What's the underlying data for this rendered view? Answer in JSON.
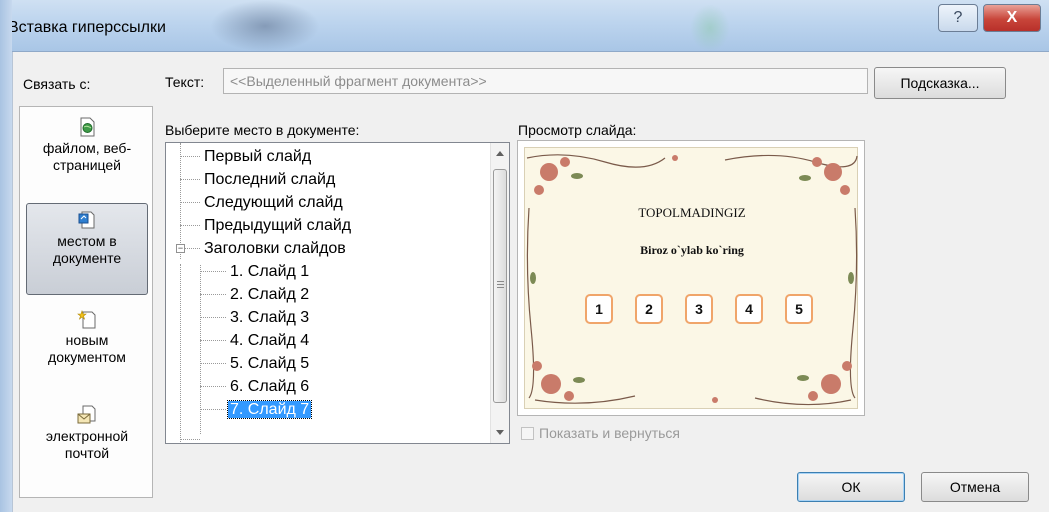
{
  "window": {
    "title": "Вставка гиперссылки",
    "help_glyph": "?",
    "close_glyph": "X"
  },
  "link_to": {
    "label": "Связать с:",
    "options": [
      {
        "icon": "web-page-file-icon",
        "label_lines": [
          "файлом, веб-",
          "страницей"
        ],
        "selected": false
      },
      {
        "icon": "document-place-icon",
        "label_lines": [
          "местом в",
          "документе"
        ],
        "selected": true
      },
      {
        "icon": "new-document-icon",
        "label_lines": [
          "новым",
          "документом"
        ],
        "selected": false
      },
      {
        "icon": "email-icon",
        "label_lines": [
          "электронной",
          "почтой"
        ],
        "selected": false
      }
    ]
  },
  "text_field": {
    "label": "Текст:",
    "value": "<<Выделенный фрагмент документа>>"
  },
  "hint_button": "Подсказка...",
  "place": {
    "label": "Выберите место в документе:",
    "items": [
      {
        "text": "Первый слайд",
        "level": 0
      },
      {
        "text": "Последний слайд",
        "level": 0
      },
      {
        "text": "Следующий слайд",
        "level": 0
      },
      {
        "text": "Предыдущий слайд",
        "level": 0
      },
      {
        "text": "Заголовки слайдов",
        "level": 0,
        "expander": "−"
      },
      {
        "text": "1. Слайд 1",
        "level": 1
      },
      {
        "text": "2. Слайд 2",
        "level": 1
      },
      {
        "text": "3. Слайд 3",
        "level": 1
      },
      {
        "text": "4. Слайд 4",
        "level": 1
      },
      {
        "text": "5. Слайд 5",
        "level": 1
      },
      {
        "text": "6. Слайд 6",
        "level": 1
      },
      {
        "text": "7. Слайд 7",
        "level": 1,
        "selected": true
      }
    ]
  },
  "preview": {
    "label": "Просмотр слайда:",
    "slide_title": "TOPOLMADINGIZ",
    "slide_subtitle": "Biroz o`ylab ko`ring",
    "numbers": [
      "1",
      "2",
      "3",
      "4",
      "5"
    ]
  },
  "show_and_return": {
    "label": "Показать и вернуться",
    "checked": false,
    "enabled": false
  },
  "buttons": {
    "ok": "ОК",
    "cancel": "Отмена"
  },
  "colors": {
    "selection": "#3399ff",
    "number_border": "#f0a56a",
    "slide_background": "#fbf7e6"
  }
}
